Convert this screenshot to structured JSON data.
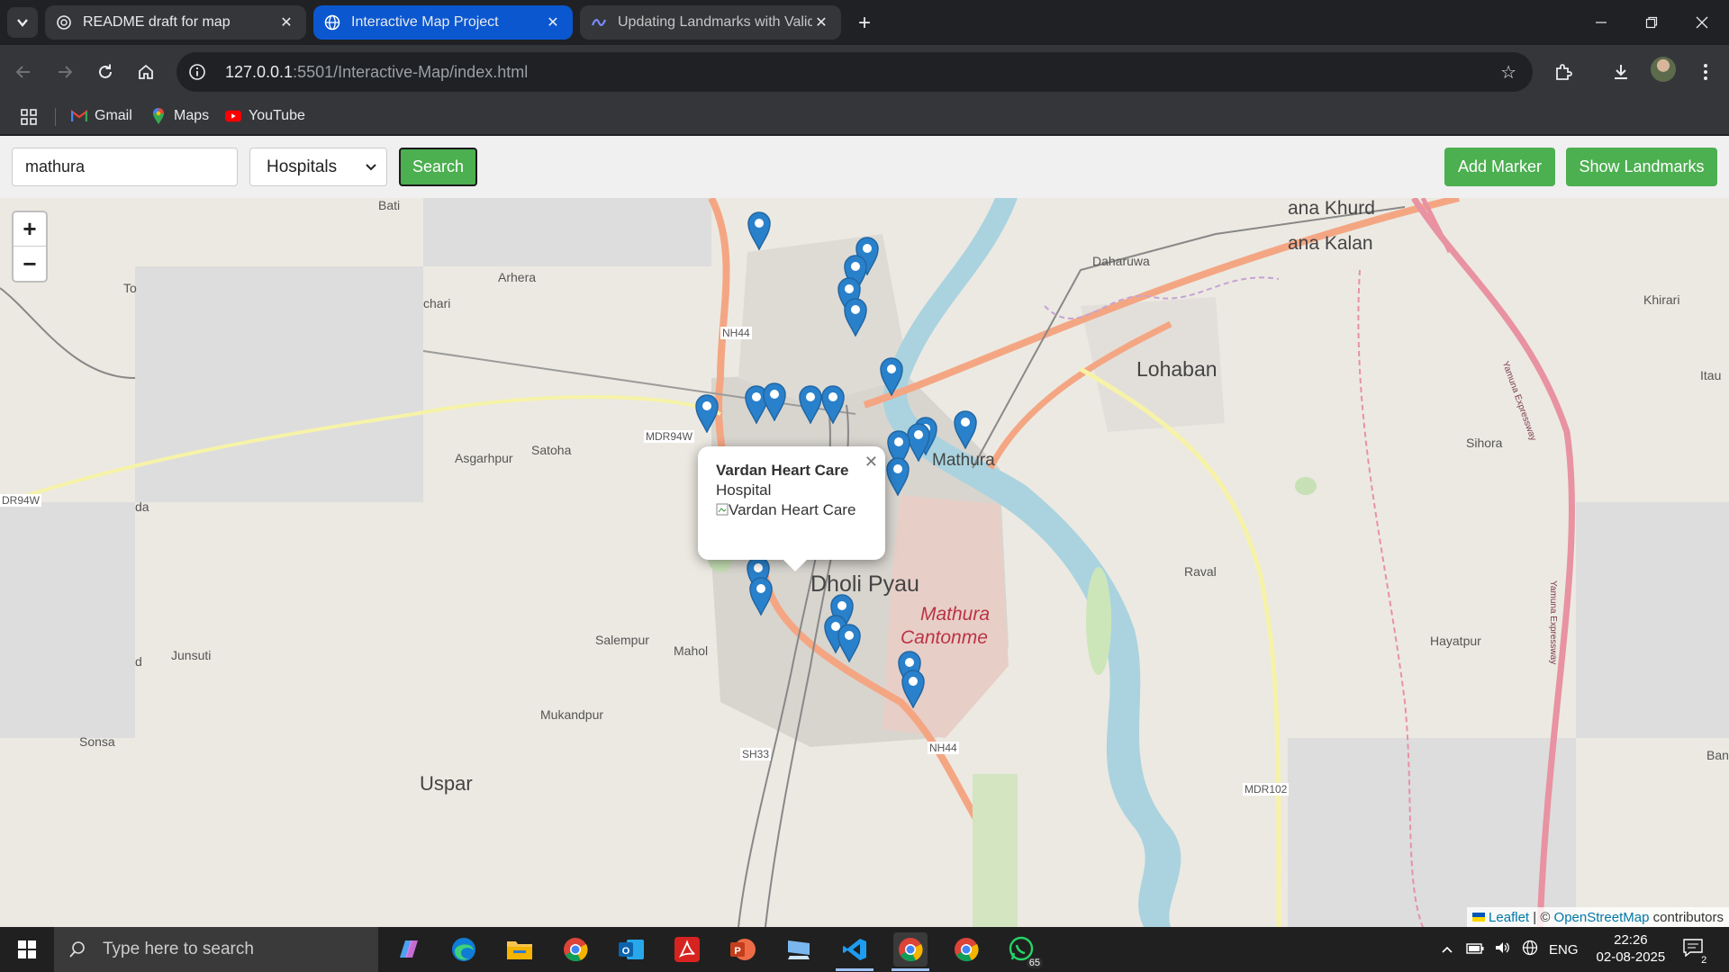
{
  "browser": {
    "tabs": [
      {
        "title": "README draft for map",
        "icon": "openai-icon"
      },
      {
        "title": "Interactive Map Project",
        "icon": "globe-icon"
      },
      {
        "title": "Updating Landmarks with Valid",
        "icon": "gemini-icon"
      }
    ],
    "url_host": "127.0.0.1",
    "url_path": ":5501/Interactive-Map/index.html",
    "bookmarks": [
      "Gmail",
      "Maps",
      "YouTube"
    ]
  },
  "controls": {
    "search_value": "mathura",
    "category_selected": "Hospitals",
    "search_label": "Search",
    "add_marker_label": "Add Marker",
    "show_landmarks_label": "Show Landmarks"
  },
  "map": {
    "labels": {
      "bati": "Bati",
      "arhera": "Arhera",
      "chari": "chari",
      "to": "To",
      "daharuwa": "Daharuwa",
      "pana_khurd": "ana Khurd",
      "pana_kalan": "ana Kalan",
      "khirari": "Khirari",
      "lohaban": "Lohaban",
      "itau": "Itau",
      "sihora": "Sihora",
      "mathura": "Mathura",
      "satoha": "Satoha",
      "asgarhpur": "Asgarhpur",
      "mdr94w": "MDR94W",
      "mdr94w_left": "DR94W",
      "da": "da",
      "nh44_top": "NH44",
      "dholi_pyau": "Dholi Pyau",
      "mathura_cant_1": "Mathura",
      "mathura_cant_2": "Cantonme",
      "raval": "Raval",
      "hayatpur": "Hayatpur",
      "salempur": "Salempur",
      "mahol": "Mahol",
      "junsuti": "Junsuti",
      "d": "d",
      "mukandpur": "Mukandpur",
      "sonsa": "Sonsa",
      "uspar": "Uspar",
      "sh33": "SH33",
      "nh44_bottom": "NH44",
      "mdr102": "MDR102",
      "ban": "Ban",
      "yamuna1": "Yamuna Expressway",
      "yamuna2": "Yamuna Expressway"
    },
    "popup": {
      "title": "Vardan Heart Care",
      "type": "Hospital",
      "image_alt": "Vardan Heart Care"
    },
    "attribution": {
      "leaflet": "Leaflet",
      "sep": " | © ",
      "osm": "OpenStreetMap",
      "suffix": " contributors"
    }
  },
  "taskbar": {
    "search_placeholder": "Type here to search",
    "whatsapp_badge": "65",
    "lang": "ENG",
    "time": "22:26",
    "date": "02-08-2025",
    "notif_count": "2"
  }
}
